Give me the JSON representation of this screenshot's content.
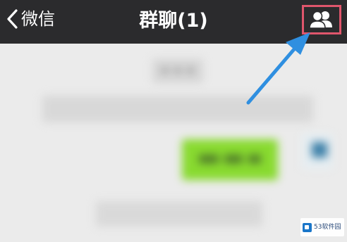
{
  "header": {
    "back_label": "微信",
    "title": "群聊(1)"
  },
  "icons": {
    "back": "chevron-left-icon",
    "members": "group-members-icon"
  },
  "colors": {
    "header_background": "#2b2b2d",
    "chat_background": "#ebebeb",
    "highlight_border": "#e0566c",
    "annotation_arrow": "#2f8fe0",
    "sent_bubble": "#88da2f"
  },
  "watermark": {
    "text": "53软件园"
  }
}
